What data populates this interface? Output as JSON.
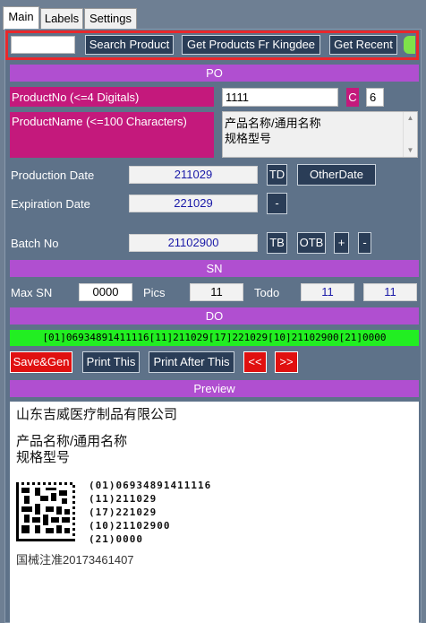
{
  "tabs": [
    "Main",
    "Labels",
    "Settings"
  ],
  "toolbar": {
    "search_value": "",
    "search_button": "Search Product",
    "kingdee_button": "Get Products Fr Kingdee",
    "recent_button": "Get Recent"
  },
  "po": {
    "header": "PO",
    "product_no_label": "ProductNo (<=4 Digitals)",
    "product_no_value": "1111",
    "c_badge": "C",
    "c_value": "6",
    "product_name_label": "ProductName (<=100 Characters)",
    "product_name_line1": "产品名称/通用名称",
    "product_name_line2": "规格型号",
    "production_date_label": "Production Date",
    "production_date_value": "211029",
    "td_button": "TD",
    "other_date_button": "OtherDate",
    "expiration_date_label": "Expiration Date",
    "expiration_date_value": "221029",
    "minus_button": "-",
    "batch_no_label": "Batch No",
    "batch_no_value": "21102900",
    "tb_button": "TB",
    "otb_button": "OTB",
    "plus_button": "+",
    "minus_button2": "-"
  },
  "sn": {
    "header": "SN",
    "max_sn_label": "Max SN",
    "max_sn_value": "0000",
    "pics_label": "Pics",
    "pics_value": "11",
    "todo_label": "Todo",
    "todo_value1": "11",
    "todo_value2": "11"
  },
  "do": {
    "header": "DO",
    "code_string": "[01]06934891411116[11]211029[17]221029[10]21102900[21]0000",
    "save_gen_button": "Save&Gen",
    "print_this_button": "Print This",
    "print_after_button": "Print After This",
    "prev_button": "<<",
    "next_button": ">>"
  },
  "preview": {
    "header": "Preview",
    "company": "山东吉威医疗制品有限公司",
    "name_line1": "产品名称/通用名称",
    "name_line2": "规格型号",
    "ai_lines": [
      "(01)06934891411116",
      "(11)211029",
      "(17)221029",
      "(10)21102900",
      "(21)0000"
    ],
    "registration": "国械注准20173461407"
  },
  "colors": {
    "accent_bar": "#b04fd0",
    "magenta_label": "#c4197c",
    "code_green": "#22ee22",
    "red_button": "#e01010",
    "dark_button": "#2a3d57"
  }
}
